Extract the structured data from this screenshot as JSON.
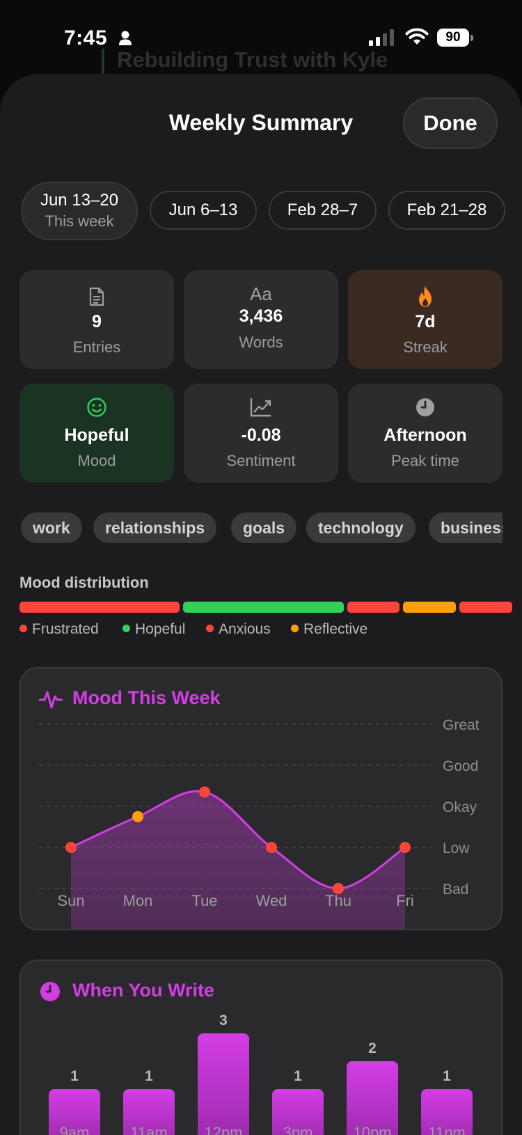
{
  "status_bar": {
    "time": "7:45",
    "battery": "90"
  },
  "background": {
    "title": "Rebuilding Trust with Kyle"
  },
  "header": {
    "title": "Weekly Summary",
    "done_label": "Done"
  },
  "weeks": [
    {
      "range": "Jun 13–20",
      "sub": "This week",
      "selected": true
    },
    {
      "range": "Jun 6–13",
      "sub": "",
      "selected": false
    },
    {
      "range": "Feb 28–7",
      "sub": "",
      "selected": false
    },
    {
      "range": "Feb 21–28",
      "sub": "",
      "selected": false
    }
  ],
  "stats": [
    {
      "icon": "document-icon",
      "value": "9",
      "label": "Entries"
    },
    {
      "icon": "aa-icon",
      "icon_text": "Aa",
      "value": "3,436",
      "label": "Words"
    },
    {
      "icon": "flame-icon",
      "value": "7d",
      "label": "Streak"
    },
    {
      "icon": "smiley-icon",
      "value": "Hopeful",
      "label": "Mood"
    },
    {
      "icon": "trend-icon",
      "value": "-0.08",
      "label": "Sentiment"
    },
    {
      "icon": "clock-icon",
      "value": "Afternoon",
      "label": "Peak time"
    }
  ],
  "tags": [
    "work",
    "relationships",
    "goals",
    "technology",
    "business"
  ],
  "mood_distribution": {
    "title": "Mood distribution",
    "segments": [
      {
        "mood": "Frustrated",
        "color": "#ff453a"
      },
      {
        "mood": "Hopeful",
        "color": "#30d158"
      },
      {
        "mood": "Anxious",
        "color": "#ff453a"
      },
      {
        "mood": "Reflective",
        "color": "#ff9f0a"
      },
      {
        "mood": "Frustrated",
        "color": "#ff453a"
      }
    ],
    "legend": [
      {
        "label": "Frustrated",
        "color": "#ff453a"
      },
      {
        "label": "Hopeful",
        "color": "#30d158"
      },
      {
        "label": "Anxious",
        "color": "#ff453a"
      },
      {
        "label": "Reflective",
        "color": "#ff9f0a"
      }
    ]
  },
  "mood_chart": {
    "title": "Mood This Week",
    "chart_data": {
      "type": "line",
      "title": "Mood This Week",
      "categories": [
        "Sun",
        "Mon",
        "Tue",
        "Wed",
        "Thu",
        "Fri"
      ],
      "y_levels": [
        "Bad",
        "Low",
        "Okay",
        "Good",
        "Great"
      ],
      "values": [
        1,
        1.75,
        2.35,
        1,
        0,
        1
      ],
      "point_colors": [
        "#ff453a",
        "#ff9f0a",
        "#ff453a",
        "#ff453a",
        "#ff453a",
        "#ff453a"
      ],
      "line_color": "#d43de6",
      "grid": true
    }
  },
  "write_chart": {
    "title": "When You Write",
    "chart_data": {
      "type": "bar",
      "title": "When You Write",
      "categories": [
        "9am",
        "11am",
        "12pm",
        "3pm",
        "10pm",
        "11pm"
      ],
      "values": [
        1,
        1,
        3,
        1,
        2,
        1
      ],
      "color": "#d43de6"
    }
  }
}
